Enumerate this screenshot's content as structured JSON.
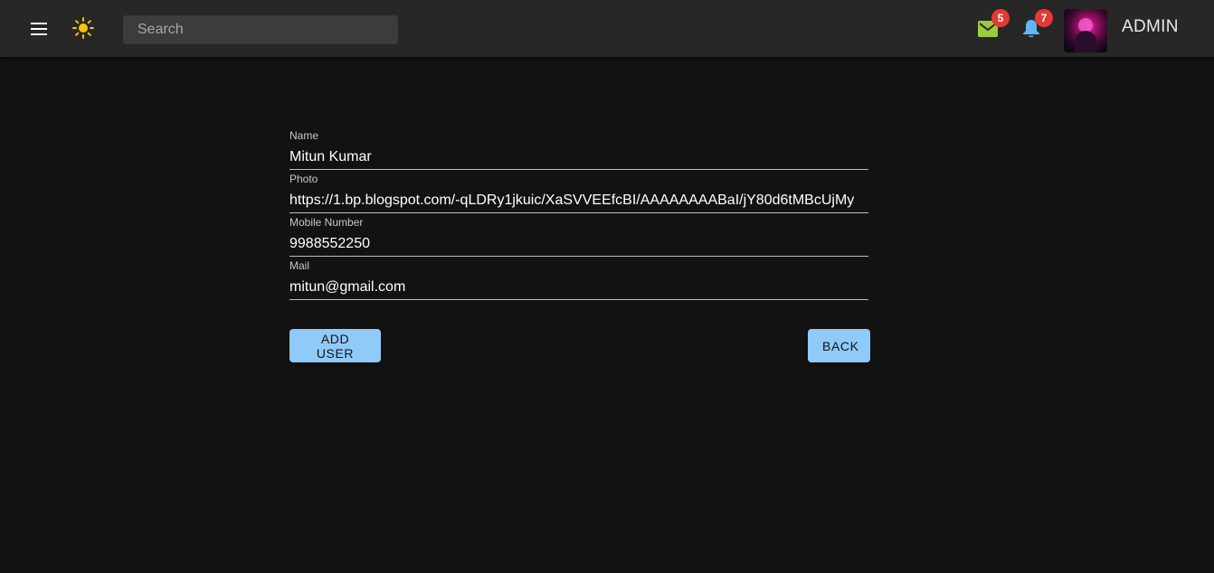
{
  "header": {
    "search": {
      "placeholder": "Search",
      "value": ""
    },
    "mail_badge": "5",
    "notification_badge": "7",
    "user_name": "ADMIN",
    "icons": {
      "menu": "menu-icon",
      "theme": "sun-icon",
      "mail": "mail-icon",
      "notifications": "bell-icon"
    }
  },
  "form": {
    "fields": [
      {
        "label": "Name",
        "value": "Mitun Kumar"
      },
      {
        "label": "Photo",
        "value": "https://1.bp.blogspot.com/-qLDRy1jkuic/XaSVVEEfcBI/AAAAAAAABaI/jY80d6tMBcUjMy"
      },
      {
        "label": "Mobile Number",
        "value": "9988552250"
      },
      {
        "label": "Mail",
        "value": "mitun@gmail.com"
      }
    ],
    "add_button": "ADD USER",
    "back_button": "BACK"
  },
  "colors": {
    "background": "#121212",
    "appbar": "#272727",
    "button": "#90caf9",
    "badge": "#e53935",
    "mail_icon": "#9ccc3c",
    "bell_icon": "#64b5f6",
    "sun_icon": "#ffc107"
  }
}
